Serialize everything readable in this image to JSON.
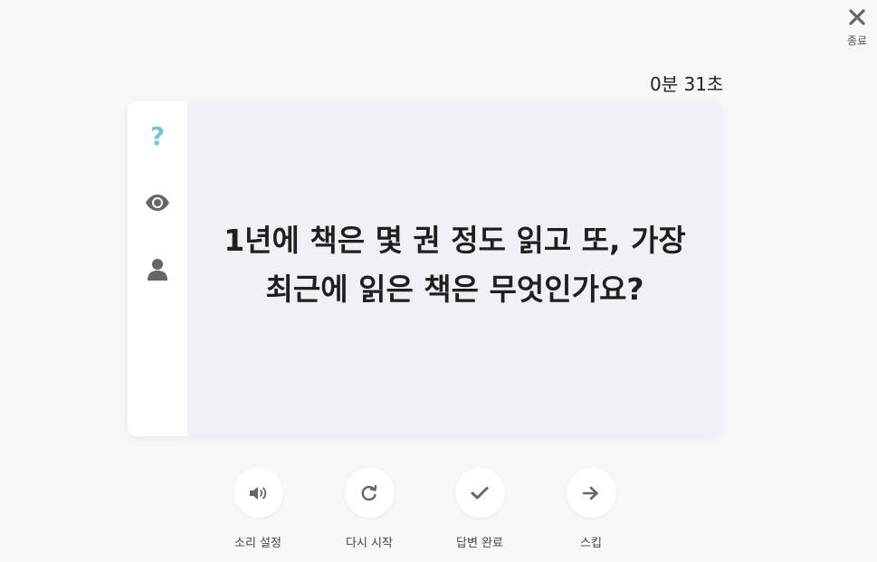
{
  "header": {
    "close_label": "종료",
    "close_icon": "close-icon",
    "timer": "0분 31초"
  },
  "card": {
    "sidebar_icons": [
      "question-icon",
      "eye-icon",
      "person-icon"
    ],
    "question_mark": "?",
    "question_line1": "1년에 책은 몇 권 정도 읽고 또, 가장",
    "question_line2": "최근에 읽은 책은 무엇인가요?"
  },
  "controls": [
    {
      "label": "소리 설정",
      "icon": "volume-icon"
    },
    {
      "label": "다시 시작",
      "icon": "restart-icon"
    },
    {
      "label": "답변 완료",
      "icon": "check-icon"
    },
    {
      "label": "스킵",
      "icon": "arrow-right-icon"
    }
  ],
  "colors": {
    "background": "#f8f8f8",
    "card_main": "#eef2f6",
    "accent": "#7cc3d0",
    "icon_gray": "#666666"
  }
}
